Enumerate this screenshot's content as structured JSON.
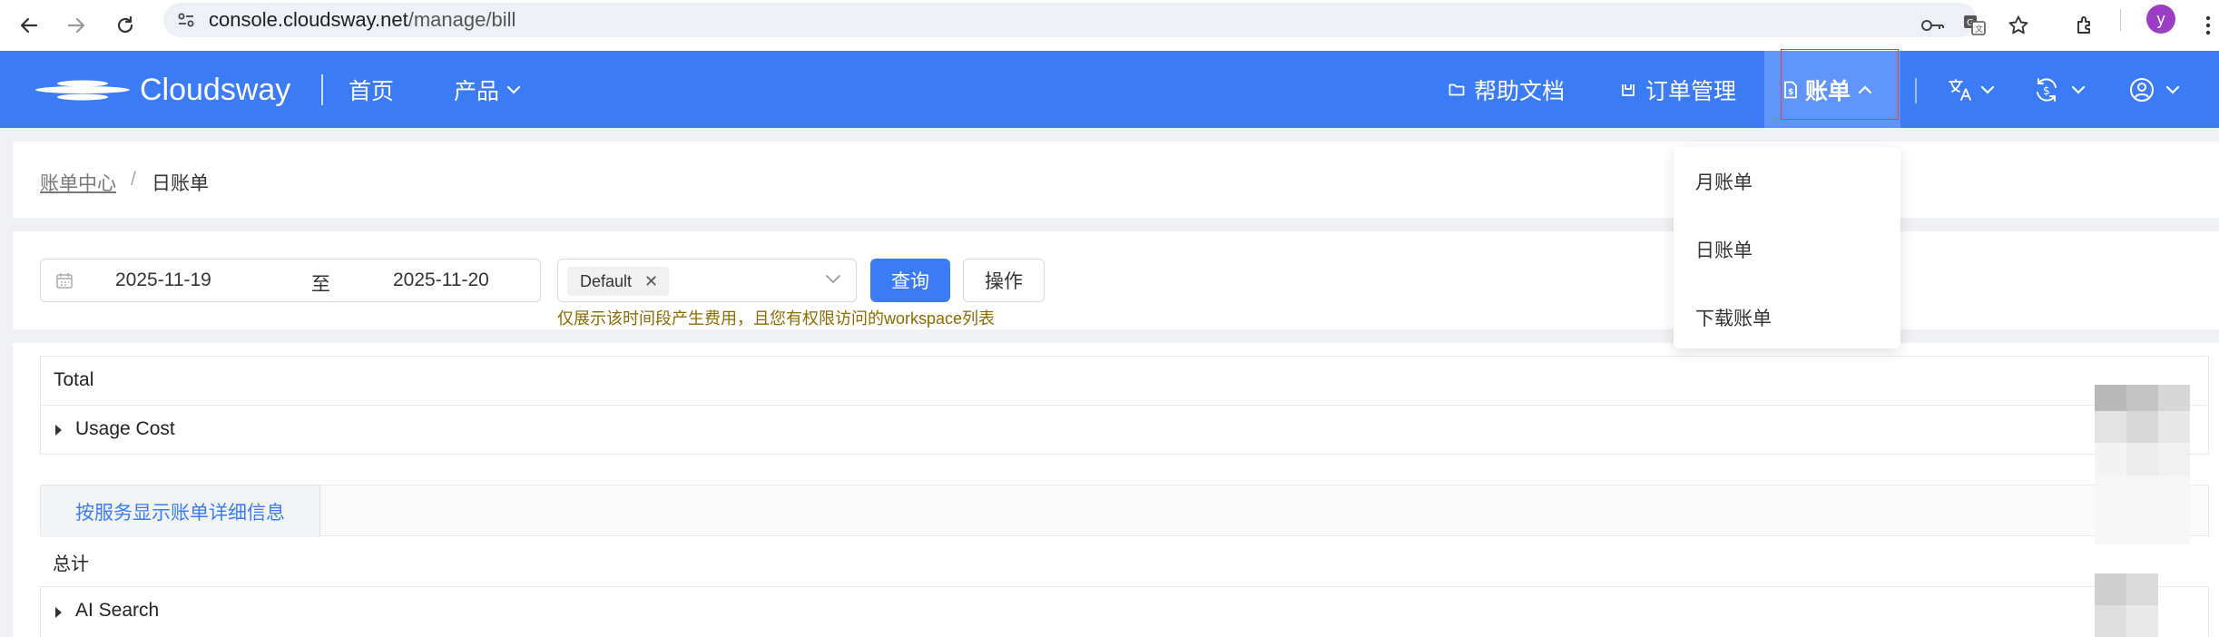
{
  "browser": {
    "url_host": "console.cloudsway.net",
    "url_path": "/manage/bill",
    "profile_initial": "y"
  },
  "nav": {
    "brand": "Cloudsway",
    "home": "首页",
    "products": "产品",
    "help_docs": "帮助文档",
    "orders": "订单管理",
    "bill": "账单"
  },
  "bill_menu": {
    "items": [
      "月账单",
      "日账单",
      "下载账单"
    ]
  },
  "breadcrumb": {
    "parent": "账单中心",
    "separator": "/",
    "current": "日账单"
  },
  "filter": {
    "date_start": "2025-11-19",
    "date_separator": "至",
    "date_end": "2025-11-20",
    "workspace_tag": "Default",
    "query_label": "查询",
    "action_label": "操作",
    "hint": "仅展示该时间段产生费用，且您有权限访问的workspace列表"
  },
  "summary": {
    "total_label": "Total",
    "usage_cost_label": "Usage Cost"
  },
  "detail": {
    "tab_label": "按服务显示账单详细信息",
    "total_label": "总计",
    "service_row": "AI Search"
  },
  "colors": {
    "brand_blue": "#3b7cf6",
    "active_nav": "#5f95f8",
    "hint": "#8a6d00",
    "highlight_box": "#e5443b"
  }
}
